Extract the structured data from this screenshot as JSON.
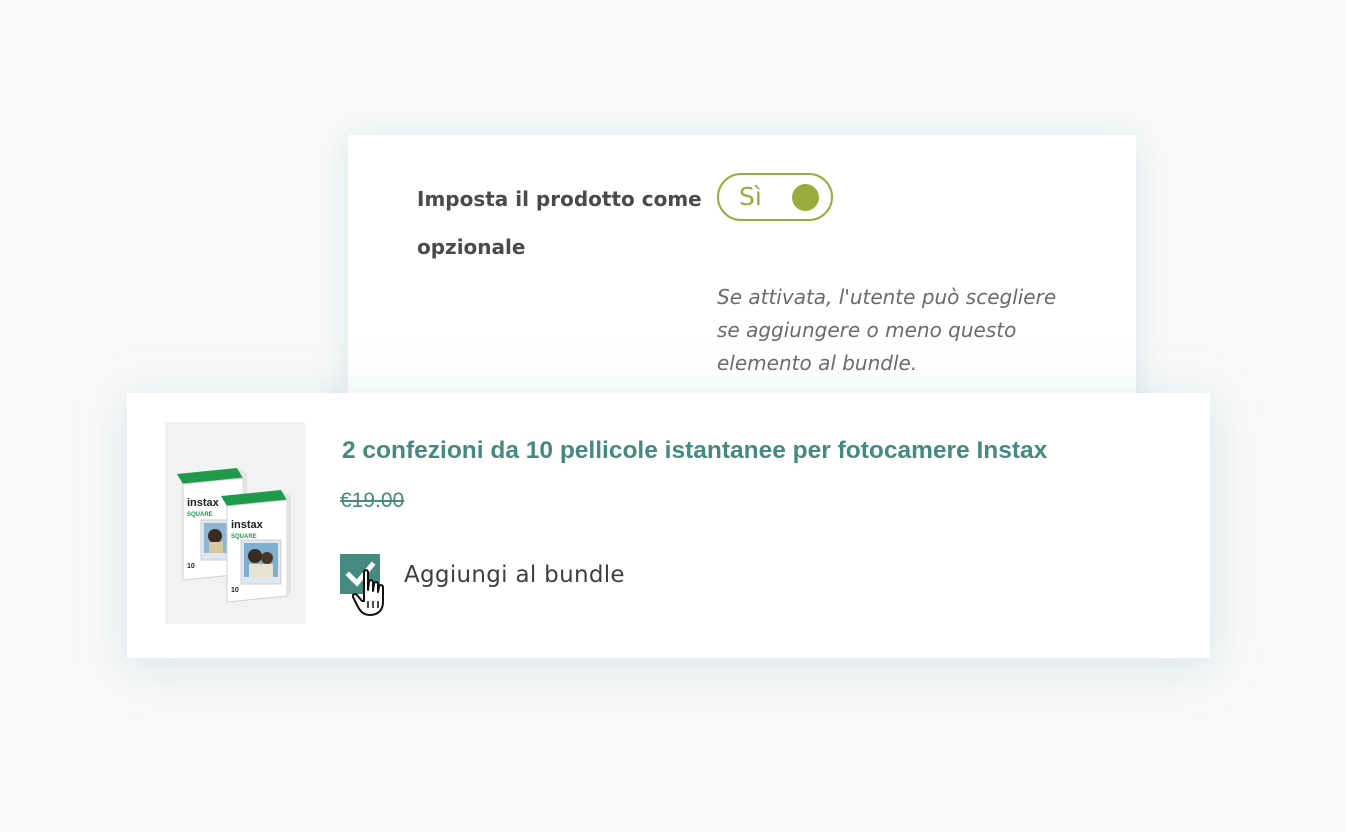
{
  "settings": {
    "label": "Imposta il prodotto come opzionale",
    "toggle_text": "Sì",
    "toggle_state": true,
    "help_text": "Se attivata, l'utente può scegliere se aggiungere o meno questo elemento al bundle.",
    "accent_color": "#9aab3e"
  },
  "product": {
    "title": "2 confezioni da 10 pellicole istantanee per fotocamere Instax",
    "price": "€19.00",
    "image_brand_text": "instax",
    "image_sub_text": "SQUARE",
    "image_count_text": "10",
    "bundle_checkbox_checked": true,
    "bundle_label": "Aggiungi al bundle",
    "accent_color": "#448a80"
  },
  "icons": {
    "checkbox": "checkmark-icon",
    "cursor": "hand-pointer-icon"
  }
}
